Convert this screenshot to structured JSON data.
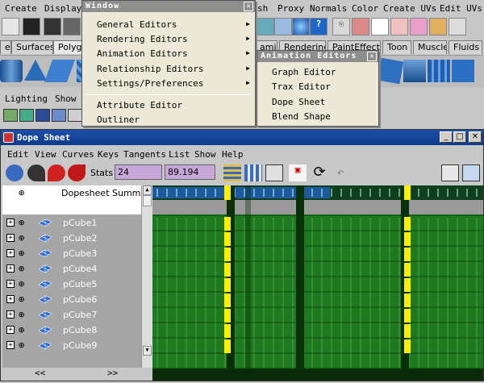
{
  "main_menu": [
    "Create",
    "Display",
    "Window",
    "sh",
    "Proxy",
    "Normals",
    "Color",
    "Create UVs",
    "Edit UVs"
  ],
  "shelf_tabs": [
    "es",
    "Surfaces",
    "Polygo",
    "amics",
    "Rendering",
    "PaintEffects",
    "Toon",
    "Muscle",
    "Fluids"
  ],
  "panel_menu": [
    "Lighting",
    "Show"
  ],
  "window_menu": {
    "title": "Window",
    "items": [
      "General Editors",
      "Rendering Editors",
      "Animation Editors",
      "Relationship Editors",
      "Settings/Preferences"
    ],
    "items2": [
      "Attribute Editor",
      "Outliner"
    ]
  },
  "anim_submenu": {
    "title": "Animation Editors",
    "items": [
      "Graph Editor",
      "Trax Editor",
      "Dope Sheet",
      "Blend Shape"
    ]
  },
  "dope_sheet": {
    "title": "Dope Sheet",
    "menu": [
      "Edit",
      "View",
      "Curves",
      "Keys",
      "Tangents",
      "List",
      "Show",
      "Help"
    ],
    "stats_label": "Stats",
    "stats_value1": "24",
    "stats_value2": "89.194",
    "summary_label": "Dopesheet Summ",
    "objects": [
      "pCube1",
      "pCube2",
      "pCube3",
      "pCube4",
      "pCube5",
      "pCube6",
      "pCube7",
      "pCube8",
      "pCube9"
    ],
    "scroll_left": "<<",
    "scroll_right": ">>",
    "colors": {
      "summary_bar": "#1e5aa0",
      "track": "#1e7a1e",
      "key": "#ffee00",
      "title": "#1b4fa8"
    }
  }
}
